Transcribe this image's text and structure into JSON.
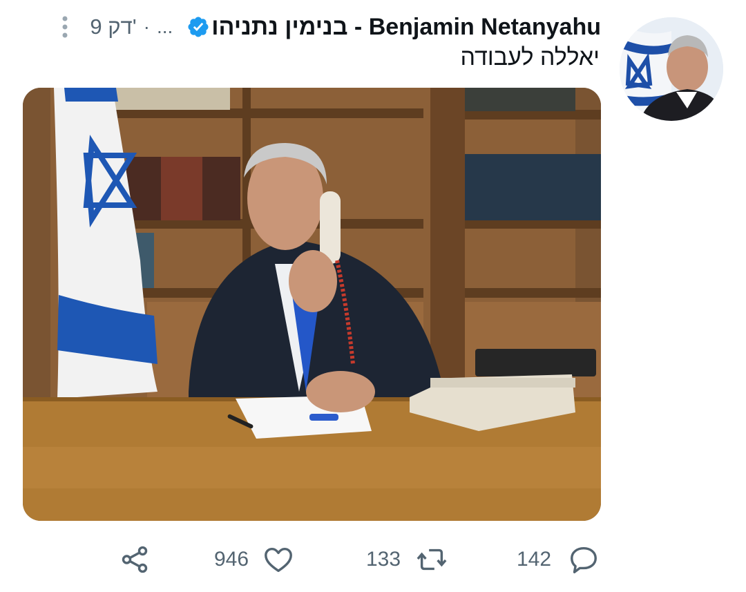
{
  "tweet": {
    "author": {
      "display_name": "בנימין נתניהו - Benjamin Netanyahu",
      "verified": true
    },
    "time": "9 דק'",
    "separator": "·",
    "ellipsis": "...",
    "text": "יאללה לעבודה",
    "media": {
      "type": "photo"
    }
  },
  "actions": {
    "reply_count": "142",
    "retweet_count": "133",
    "like_count": "946"
  },
  "icons": {
    "more": "more-vertical-icon",
    "verified": "verified-badge-icon",
    "reply": "reply-icon",
    "retweet": "retweet-icon",
    "like": "heart-icon",
    "share": "share-icon"
  },
  "colors": {
    "verified": "#1d9bf0",
    "secondary_text": "#536471",
    "primary_text": "#0f1419"
  }
}
